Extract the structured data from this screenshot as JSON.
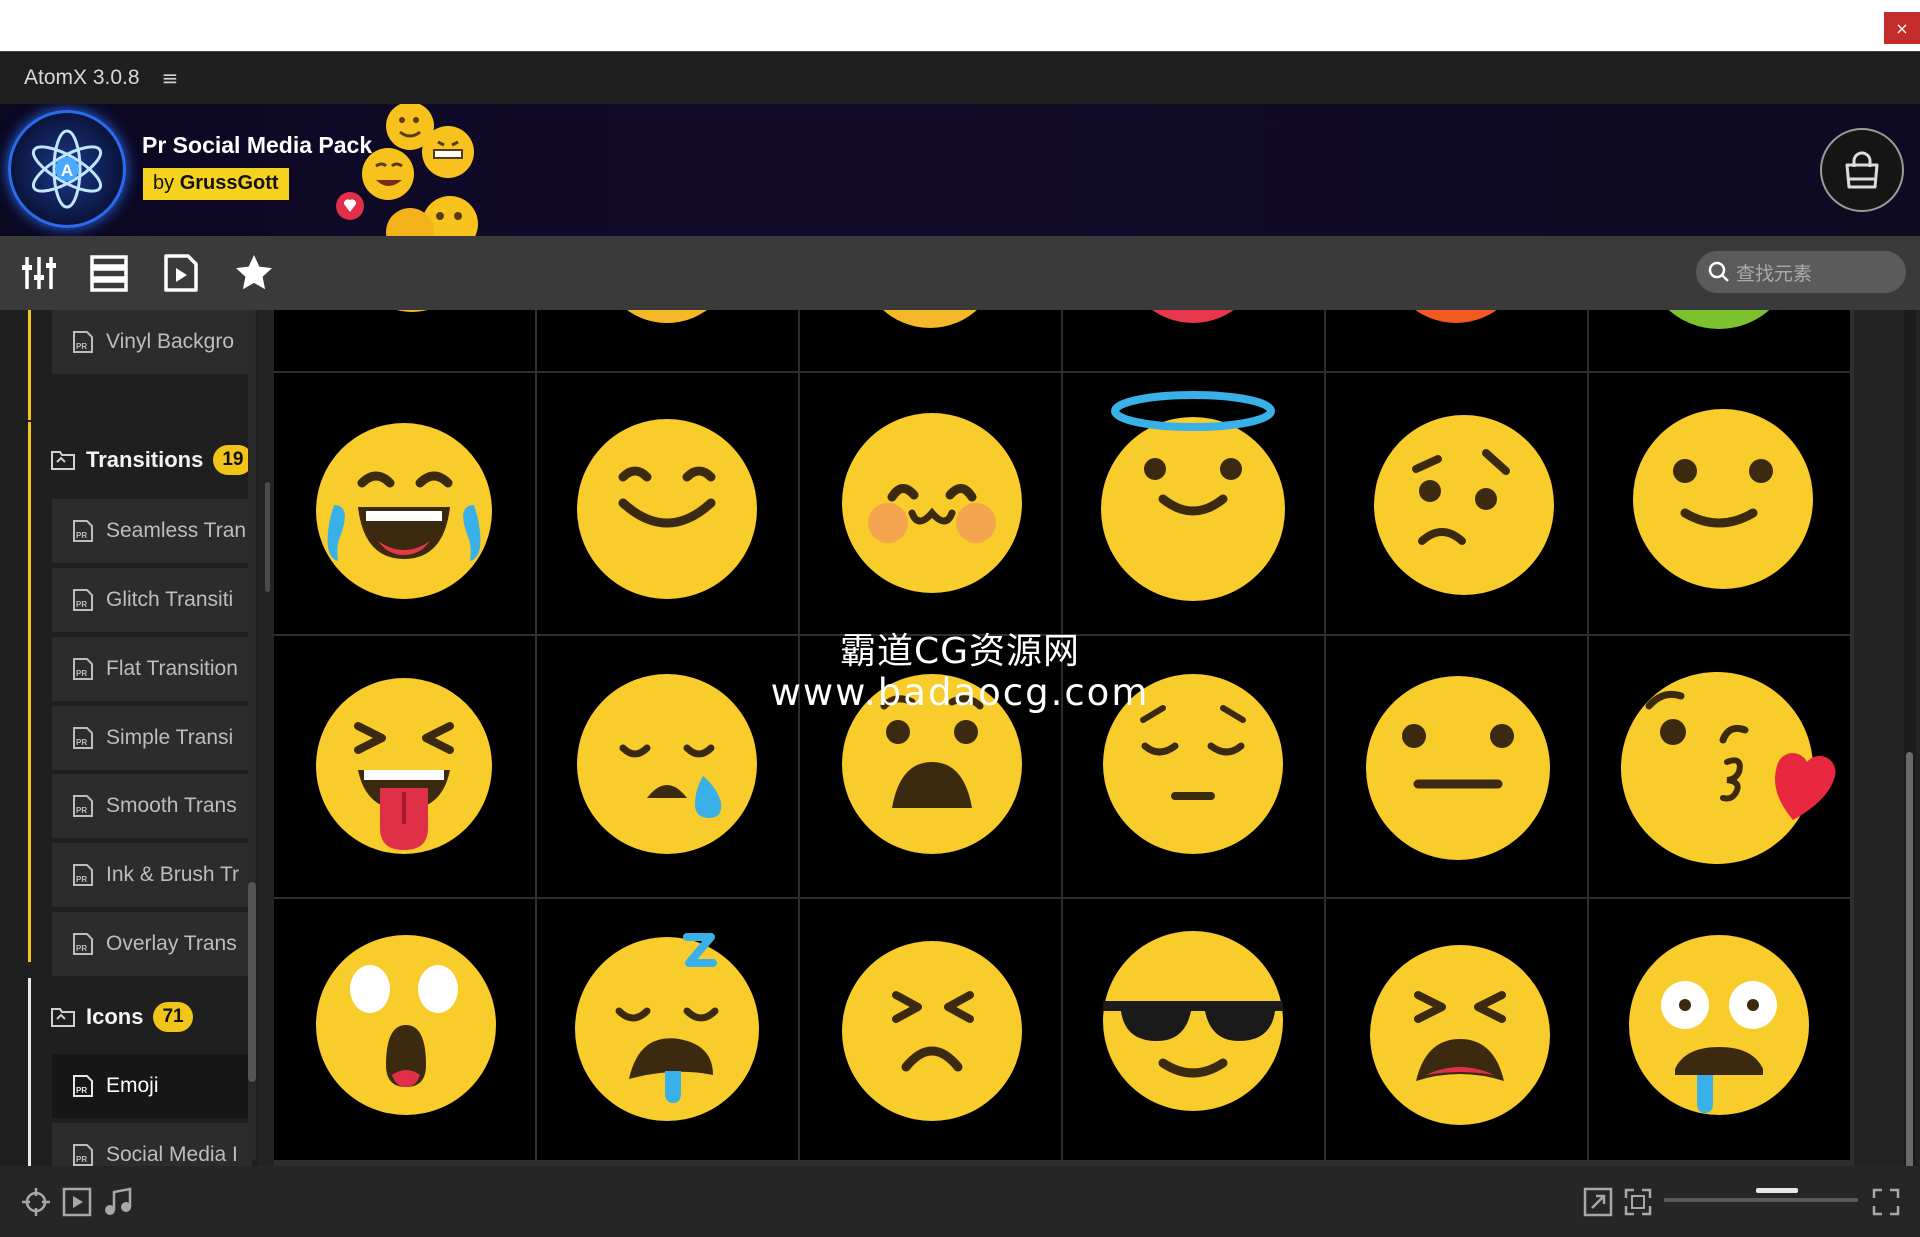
{
  "window": {
    "close_label": "×"
  },
  "app": {
    "title": "AtomX 3.0.8",
    "menu_icon": "≡"
  },
  "banner": {
    "pack_title": "Pr Social Media Pack",
    "by_prefix": "by",
    "author": "GrussGott"
  },
  "search": {
    "placeholder": "查找元素"
  },
  "sidebar": {
    "items_top": [
      {
        "label": "Vinyl Backgro"
      }
    ],
    "categories": [
      {
        "label": "Transitions",
        "count": "19"
      },
      {
        "label": "Icons",
        "count": "71"
      }
    ],
    "transitions": [
      {
        "label": "Seamless Tran"
      },
      {
        "label": "Glitch Transiti"
      },
      {
        "label": "Flat Transition"
      },
      {
        "label": "Simple Transi"
      },
      {
        "label": "Smooth Trans"
      },
      {
        "label": "Ink & Brush Tr"
      },
      {
        "label": "Overlay Trans"
      }
    ],
    "icons": [
      {
        "label": "Emoji"
      },
      {
        "label": "Social Media I"
      }
    ]
  },
  "watermark": {
    "line1": "霸道CG资源网",
    "line2": "www.badaocg.com"
  },
  "grid": {
    "items": [
      "laughing-tears-emoji",
      "smile-emoji",
      "blush-cute-emoji",
      "angel-halo-emoji",
      "worried-emoji",
      "slight-smile-emoji",
      "squint-tongue-emoji",
      "sad-tear-emoji",
      "shocked-frown-emoji",
      "pensive-emoji",
      "neutral-face-emoji",
      "kiss-heart-emoji",
      "astonished-emoji",
      "sleepy-drool-emoji",
      "persevere-emoji",
      "sunglasses-emoji",
      "tired-face-emoji",
      "drooling-eyes-emoji"
    ],
    "peek_colors": [
      "#f4b928",
      "#f4b928",
      "#f4b928",
      "#e8374b",
      "#f25a1f",
      "#7cc22e"
    ]
  },
  "colors": {
    "accent": "#f0c419",
    "emoji_yellow": "#f8cc2a"
  }
}
